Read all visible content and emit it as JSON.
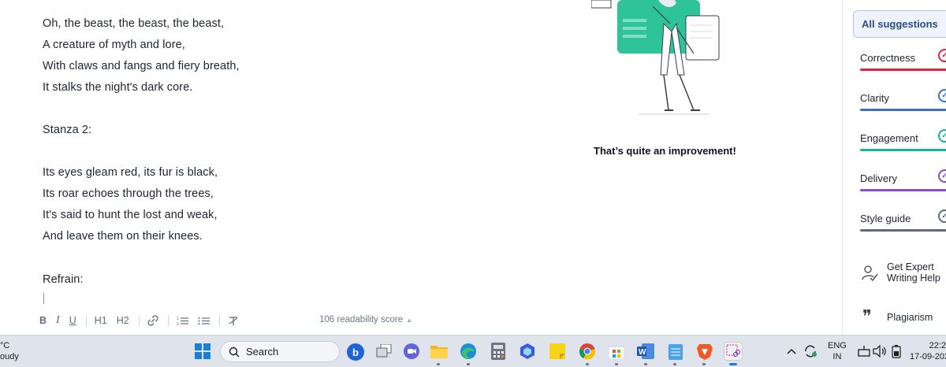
{
  "editor": {
    "lines": [
      "Oh, the beast, the beast, the beast,",
      "A creature of myth and lore,",
      "With claws and fangs and fiery breath,",
      "It stalks the night's dark core.",
      "Stanza 2:",
      "Its eyes gleam red, its fur is black,",
      "Its roar echoes through the trees,",
      "It's said to hunt the lost and weak,",
      "And leave them on their knees.",
      "Refrain:"
    ],
    "toolbar": {
      "bold": "B",
      "italic": "I",
      "underline": "U",
      "h1": "H1",
      "h2": "H2"
    },
    "readability": "106 readability score"
  },
  "illustration_message": "That’s quite an improvement!",
  "sidebar": {
    "all_suggestions": "All suggestions",
    "categories": [
      {
        "label": "Correctness",
        "color": "#e5213f"
      },
      {
        "label": "Clarity",
        "color": "#3b6fd8"
      },
      {
        "label": "Engagement",
        "color": "#15b58f"
      },
      {
        "label": "Delivery",
        "color": "#8a4ad1"
      },
      {
        "label": "Style guide",
        "color": "#5f6b7a"
      }
    ],
    "expert": "Get Expert Writing Help",
    "plagiarism": "Plagiarism"
  },
  "taskbar": {
    "weather_temp": "°C",
    "weather_desc": "oudy",
    "search_placeholder": "Search",
    "lang_top": "ENG",
    "lang_bottom": "IN",
    "time": "22:2",
    "date": "17-09-202"
  }
}
